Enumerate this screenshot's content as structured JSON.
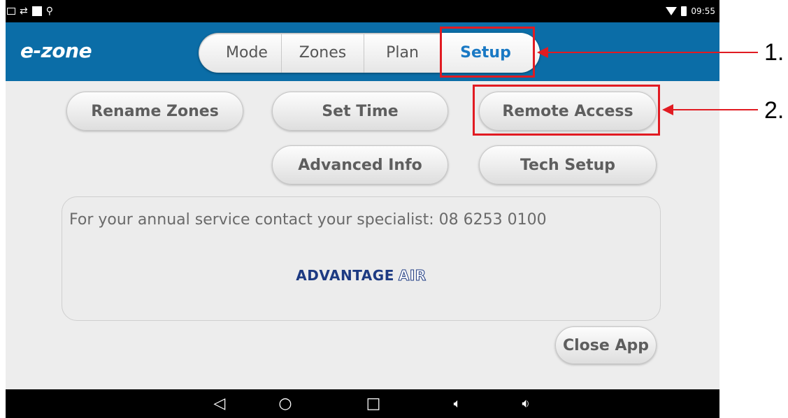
{
  "status_bar": {
    "time": "09:55"
  },
  "header": {
    "logo": "e-zone"
  },
  "tabs": [
    {
      "label": "Mode"
    },
    {
      "label": "Zones"
    },
    {
      "label": "Plan"
    },
    {
      "label": "Setup",
      "selected": true
    }
  ],
  "buttons": {
    "rename_zones": "Rename Zones",
    "set_time": "Set Time",
    "remote_access": "Remote Access",
    "advanced_info": "Advanced Info",
    "tech_setup": "Tech Setup",
    "close_app": "Close App"
  },
  "info": {
    "service_text": "For your annual service contact your specialist: 08 6253 0100",
    "brand_main": "ADVANTAGE",
    "brand_sub": "AIR"
  },
  "nav_icons": [
    "back-icon",
    "home-icon",
    "recents-icon",
    "volume-down-icon",
    "volume-up-icon"
  ],
  "annotations": {
    "callout_1": "1.",
    "callout_2": "2."
  },
  "colors": {
    "header": "#0b6da7",
    "accent": "#1a79c4",
    "highlight": "#e11b22"
  }
}
